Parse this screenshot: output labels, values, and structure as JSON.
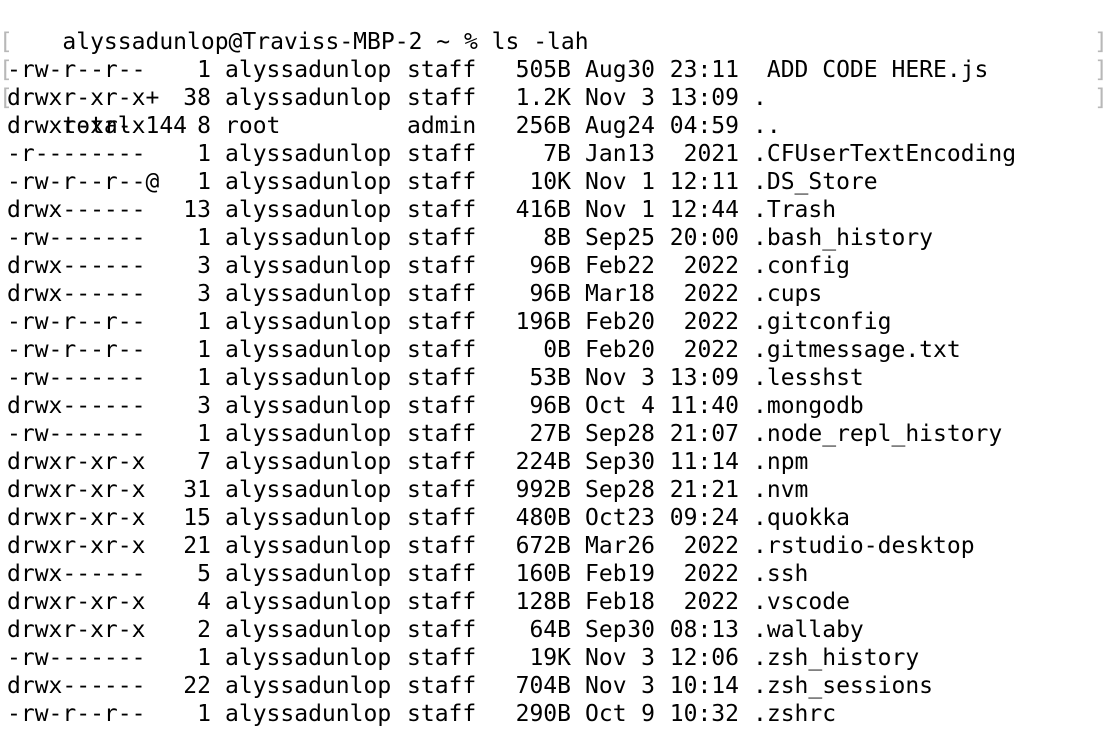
{
  "terminal": {
    "prompt": "alyssadunlop@Traviss-MBP-2 ~ % ls -lah",
    "total": "total 144",
    "entries": [
      {
        "perm": "-rw-r--r--",
        "links": "1",
        "owner": "alyssadunlop",
        "group": "staff",
        "size": "505B",
        "month": "Aug",
        "day": "30",
        "time": "23:11",
        "name": " ADD CODE HERE.js"
      },
      {
        "perm": "drwxr-xr-x+",
        "links": "38",
        "owner": "alyssadunlop",
        "group": "staff",
        "size": "1.2K",
        "month": "Nov",
        "day": "3",
        "time": "13:09",
        "name": "."
      },
      {
        "perm": "drwxr-xr-x",
        "links": "8",
        "owner": "root",
        "group": "admin",
        "size": "256B",
        "month": "Aug",
        "day": "24",
        "time": "04:59",
        "name": ".."
      },
      {
        "perm": "-r--------",
        "links": "1",
        "owner": "alyssadunlop",
        "group": "staff",
        "size": "7B",
        "month": "Jan",
        "day": "13",
        "time": "2021",
        "name": ".CFUserTextEncoding"
      },
      {
        "perm": "-rw-r--r--@",
        "links": "1",
        "owner": "alyssadunlop",
        "group": "staff",
        "size": "10K",
        "month": "Nov",
        "day": "1",
        "time": "12:11",
        "name": ".DS_Store"
      },
      {
        "perm": "drwx------",
        "links": "13",
        "owner": "alyssadunlop",
        "group": "staff",
        "size": "416B",
        "month": "Nov",
        "day": "1",
        "time": "12:44",
        "name": ".Trash"
      },
      {
        "perm": "-rw-------",
        "links": "1",
        "owner": "alyssadunlop",
        "group": "staff",
        "size": "8B",
        "month": "Sep",
        "day": "25",
        "time": "20:00",
        "name": ".bash_history"
      },
      {
        "perm": "drwx------",
        "links": "3",
        "owner": "alyssadunlop",
        "group": "staff",
        "size": "96B",
        "month": "Feb",
        "day": "22",
        "time": "2022",
        "name": ".config"
      },
      {
        "perm": "drwx------",
        "links": "3",
        "owner": "alyssadunlop",
        "group": "staff",
        "size": "96B",
        "month": "Mar",
        "day": "18",
        "time": "2022",
        "name": ".cups"
      },
      {
        "perm": "-rw-r--r--",
        "links": "1",
        "owner": "alyssadunlop",
        "group": "staff",
        "size": "196B",
        "month": "Feb",
        "day": "20",
        "time": "2022",
        "name": ".gitconfig"
      },
      {
        "perm": "-rw-r--r--",
        "links": "1",
        "owner": "alyssadunlop",
        "group": "staff",
        "size": "0B",
        "month": "Feb",
        "day": "20",
        "time": "2022",
        "name": ".gitmessage.txt"
      },
      {
        "perm": "-rw-------",
        "links": "1",
        "owner": "alyssadunlop",
        "group": "staff",
        "size": "53B",
        "month": "Nov",
        "day": "3",
        "time": "13:09",
        "name": ".lesshst"
      },
      {
        "perm": "drwx------",
        "links": "3",
        "owner": "alyssadunlop",
        "group": "staff",
        "size": "96B",
        "month": "Oct",
        "day": "4",
        "time": "11:40",
        "name": ".mongodb"
      },
      {
        "perm": "-rw-------",
        "links": "1",
        "owner": "alyssadunlop",
        "group": "staff",
        "size": "27B",
        "month": "Sep",
        "day": "28",
        "time": "21:07",
        "name": ".node_repl_history"
      },
      {
        "perm": "drwxr-xr-x",
        "links": "7",
        "owner": "alyssadunlop",
        "group": "staff",
        "size": "224B",
        "month": "Sep",
        "day": "30",
        "time": "11:14",
        "name": ".npm"
      },
      {
        "perm": "drwxr-xr-x",
        "links": "31",
        "owner": "alyssadunlop",
        "group": "staff",
        "size": "992B",
        "month": "Sep",
        "day": "28",
        "time": "21:21",
        "name": ".nvm"
      },
      {
        "perm": "drwxr-xr-x",
        "links": "15",
        "owner": "alyssadunlop",
        "group": "staff",
        "size": "480B",
        "month": "Oct",
        "day": "23",
        "time": "09:24",
        "name": ".quokka"
      },
      {
        "perm": "drwxr-xr-x",
        "links": "21",
        "owner": "alyssadunlop",
        "group": "staff",
        "size": "672B",
        "month": "Mar",
        "day": "26",
        "time": "2022",
        "name": ".rstudio-desktop"
      },
      {
        "perm": "drwx------",
        "links": "5",
        "owner": "alyssadunlop",
        "group": "staff",
        "size": "160B",
        "month": "Feb",
        "day": "19",
        "time": "2022",
        "name": ".ssh"
      },
      {
        "perm": "drwxr-xr-x",
        "links": "4",
        "owner": "alyssadunlop",
        "group": "staff",
        "size": "128B",
        "month": "Feb",
        "day": "18",
        "time": "2022",
        "name": ".vscode"
      },
      {
        "perm": "drwxr-xr-x",
        "links": "2",
        "owner": "alyssadunlop",
        "group": "staff",
        "size": "64B",
        "month": "Sep",
        "day": "30",
        "time": "08:13",
        "name": ".wallaby"
      },
      {
        "perm": "-rw-------",
        "links": "1",
        "owner": "alyssadunlop",
        "group": "staff",
        "size": "19K",
        "month": "Nov",
        "day": "3",
        "time": "12:06",
        "name": ".zsh_history"
      },
      {
        "perm": "drwx------",
        "links": "22",
        "owner": "alyssadunlop",
        "group": "staff",
        "size": "704B",
        "month": "Nov",
        "day": "3",
        "time": "10:14",
        "name": ".zsh_sessions"
      },
      {
        "perm": "-rw-r--r--",
        "links": "1",
        "owner": "alyssadunlop",
        "group": "staff",
        "size": "290B",
        "month": "Oct",
        "day": "9",
        "time": "10:32",
        "name": ".zshrc"
      }
    ],
    "marks": {
      "left_bracket": "[",
      "right_bracket": "]"
    }
  }
}
